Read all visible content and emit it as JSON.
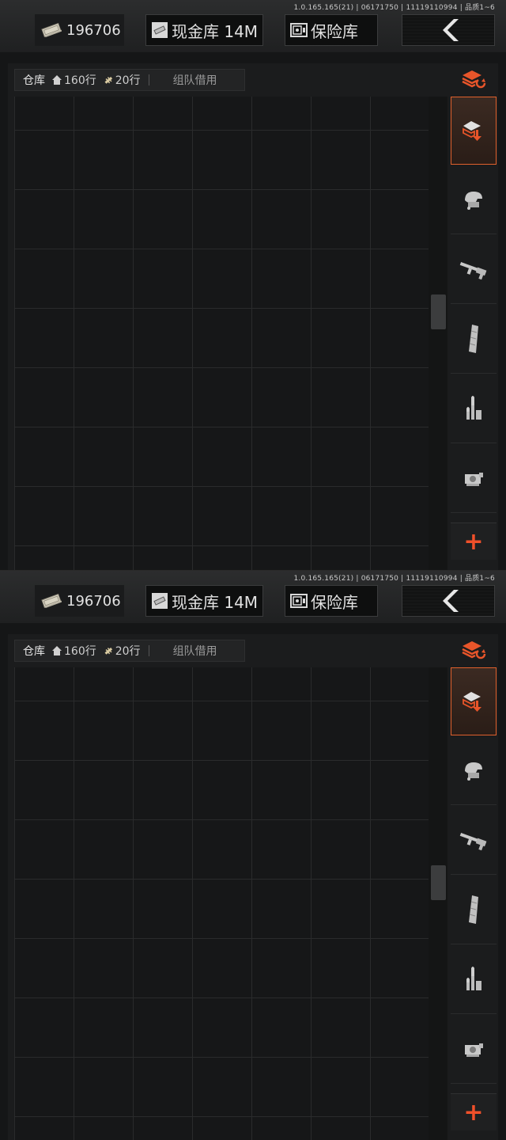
{
  "screens": [
    {
      "version": "1.0.165.165(21) | 06171750 | 11119110994 | 品质1~6",
      "currency": "196706",
      "cash_vault_label": "现金库 14M",
      "safe_label": "保险库",
      "toolbar": {
        "warehouse": "仓库",
        "rows": "160行",
        "capacity": "20行",
        "team_borrow": "组队借用"
      },
      "scroll_fraction": 0.45,
      "add_label": "+"
    },
    {
      "version": "1.0.165.165(21) | 06171750 | 11119110994 | 品质1~6",
      "currency": "196706",
      "cash_vault_label": "现金库 14M",
      "safe_label": "保险库",
      "toolbar": {
        "warehouse": "仓库",
        "rows": "160行",
        "capacity": "20行",
        "team_borrow": "组队借用"
      },
      "scroll_fraction": 0.45,
      "add_label": "+"
    }
  ],
  "side_categories": [
    "all-items-icon",
    "helmet-armor-icon",
    "rifle-icon",
    "magazine-icon",
    "ammo-icon",
    "scope-icon"
  ],
  "colors": {
    "accent": "#e0602c",
    "plus": "#f0502a",
    "background": "#151617"
  }
}
